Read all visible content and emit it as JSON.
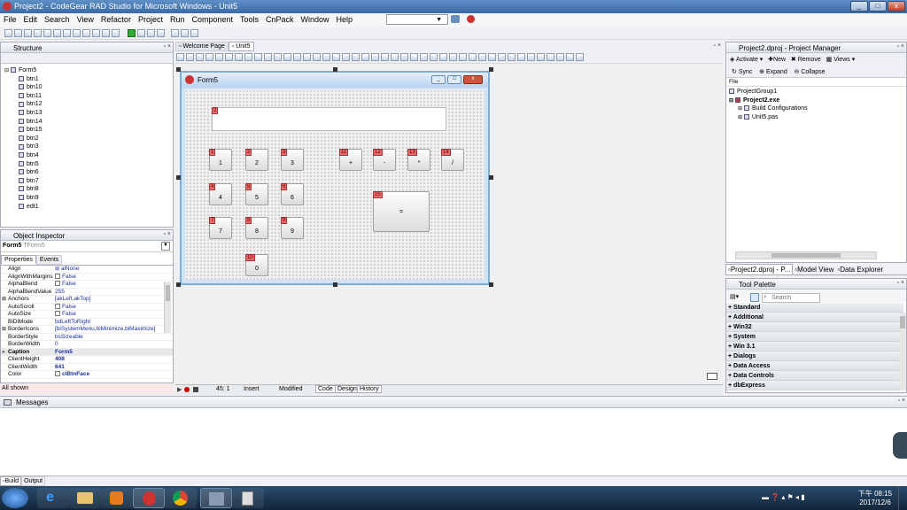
{
  "window": {
    "title": "Project2 - CodeGear RAD Studio for Microsoft Windows - Unit5"
  },
  "menu": [
    "File",
    "Edit",
    "Search",
    "View",
    "Refactor",
    "Project",
    "Run",
    "Component",
    "Tools",
    "CnPack",
    "Window",
    "Help"
  ],
  "structure": {
    "title": "Structure",
    "root": "Form5",
    "items": [
      "btn1",
      "btn10",
      "btn11",
      "btn12",
      "btn13",
      "btn14",
      "btn15",
      "btn2",
      "btn3",
      "btn4",
      "btn5",
      "btn6",
      "btn7",
      "btn8",
      "btn9",
      "edt1"
    ]
  },
  "object_inspector": {
    "title": "Object Inspector",
    "selected": "Form5",
    "selected_type": "TForm5",
    "tabs": [
      "Properties",
      "Events"
    ],
    "rows": [
      {
        "prop": "Align",
        "value": "alNone"
      },
      {
        "prop": "AlignWithMargins",
        "value": "False"
      },
      {
        "prop": "AlphaBlend",
        "value": "False"
      },
      {
        "prop": "AlphaBlendValue",
        "value": "255"
      },
      {
        "prop": "Anchors",
        "value": "[akLeft,akTop]"
      },
      {
        "prop": "AutoScroll",
        "value": "False"
      },
      {
        "prop": "AutoSize",
        "value": "False"
      },
      {
        "prop": "BiDiMode",
        "value": "bdLeftToRight"
      },
      {
        "prop": "BorderIcons",
        "value": "[biSystemMenu,biMinimize,biMaximize]"
      },
      {
        "prop": "BorderStyle",
        "value": "bsSizeable"
      },
      {
        "prop": "BorderWidth",
        "value": "0"
      },
      {
        "prop": "Caption",
        "value": "Form5"
      },
      {
        "prop": "ClientHeight",
        "value": "408"
      },
      {
        "prop": "ClientWidth",
        "value": "641"
      },
      {
        "prop": "Color",
        "value": "clBtnFace"
      }
    ],
    "footer": "All shown"
  },
  "editor_tabs": [
    "Welcome Page",
    "Unit5"
  ],
  "form": {
    "caption": "Form5",
    "edit_order": "2",
    "buttons": [
      {
        "order": "1",
        "label": "1"
      },
      {
        "order": "2",
        "label": "2"
      },
      {
        "order": "3",
        "label": "3"
      },
      {
        "order": "4",
        "label": "4"
      },
      {
        "order": "5",
        "label": "5"
      },
      {
        "order": "6",
        "label": "6"
      },
      {
        "order": "7",
        "label": "7"
      },
      {
        "order": "8",
        "label": "8"
      },
      {
        "order": "9",
        "label": "9"
      },
      {
        "order": "10",
        "label": "0"
      },
      {
        "order": "11",
        "label": "+"
      },
      {
        "order": "12",
        "label": "-"
      },
      {
        "order": "13",
        "label": "*"
      },
      {
        "order": "14",
        "label": "/"
      },
      {
        "order": "15",
        "label": "="
      }
    ]
  },
  "statusbar": {
    "position": "45:  1",
    "mode": "Insert",
    "state": "Modified",
    "tabs": [
      "Code",
      "Design",
      "History"
    ]
  },
  "project_manager": {
    "title": "Project2.dproj - Project Manager",
    "actions": [
      "Activate",
      "New",
      "Remove",
      "Views"
    ],
    "actions2": [
      "Sync",
      "Expand",
      "Collapse"
    ],
    "column": "File",
    "tree": [
      "ProjectGroup1",
      "Project2.exe",
      "Build Configurations",
      "Unit5.pas"
    ],
    "tabs": [
      "Project2.dproj - P...",
      "Model View",
      "Data Explorer"
    ]
  },
  "tool_palette": {
    "title": "Tool Palette",
    "search_placeholder": "Search",
    "categories": [
      "Standard",
      "Additional",
      "Win32",
      "System",
      "Win 3.1",
      "Dialogs",
      "Data Access",
      "Data Controls",
      "dbExpress"
    ]
  },
  "messages": {
    "title": "Messages",
    "tabs": [
      "Build",
      "Output"
    ]
  },
  "clock": {
    "time": "下午 08:15",
    "date": "2017/12/6"
  }
}
